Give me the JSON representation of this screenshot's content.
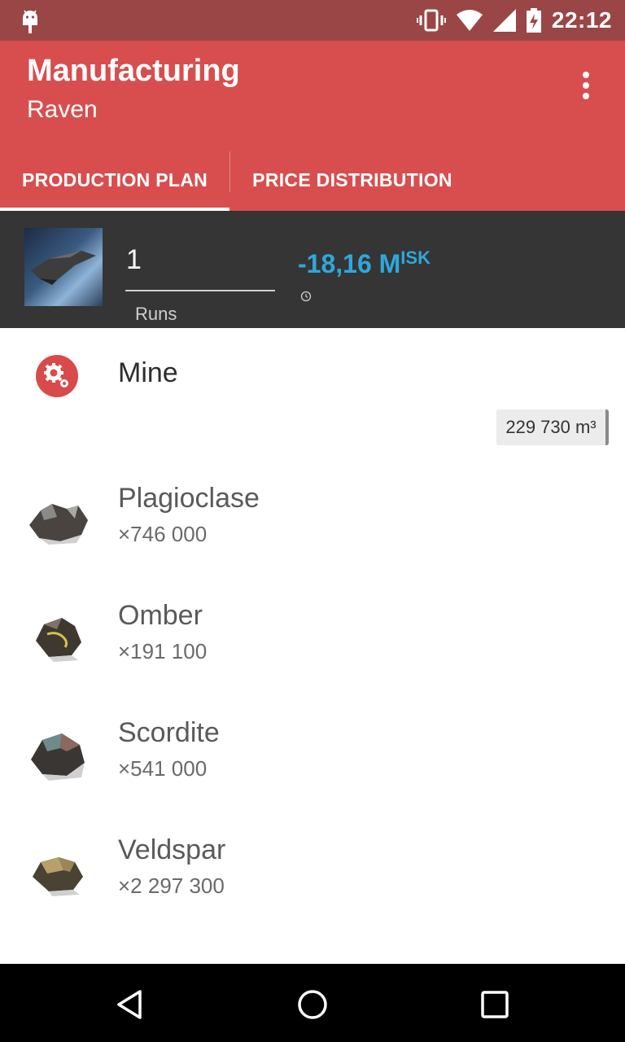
{
  "status_bar": {
    "time": "22:12",
    "icons": [
      "android-icon",
      "vibrate-icon",
      "wifi-icon",
      "cell-signal-icon",
      "battery-charging-icon"
    ]
  },
  "app_bar": {
    "title": "Manufacturing",
    "subtitle": "Raven",
    "menu_icon": "overflow-menu-icon"
  },
  "tabs": [
    {
      "label": "PRODUCTION PLAN",
      "selected": true
    },
    {
      "label": "PRICE DISTRIBUTION",
      "selected": false
    }
  ],
  "summary": {
    "runs_value": "1",
    "runs_label": "Runs",
    "price": "-18,16 M",
    "price_unit": "ISK",
    "price_color": "#2ea8dc"
  },
  "mine": {
    "label": "Mine",
    "icon": "gears-icon",
    "volume": "229 730 m³"
  },
  "ores": [
    {
      "name": "Plagioclase",
      "quantity": "×746 000"
    },
    {
      "name": "Omber",
      "quantity": "×191 100"
    },
    {
      "name": "Scordite",
      "quantity": "×541 000"
    },
    {
      "name": "Veldspar",
      "quantity": "×2 297 300"
    }
  ],
  "colors": {
    "status_bar": "#9a4646",
    "app_bar": "#d84e4e",
    "summary_bg": "#353535",
    "accent": "#2ea8dc"
  }
}
